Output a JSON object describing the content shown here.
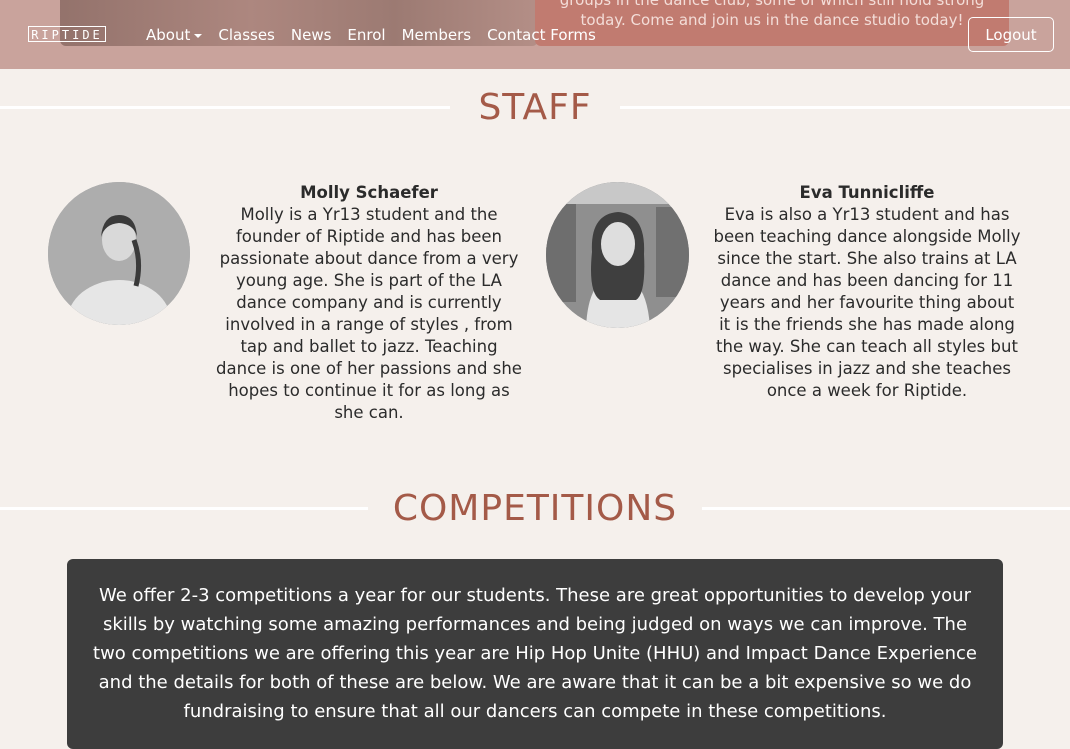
{
  "navbar": {
    "brand": "RIPTIDE",
    "hero_caption": "groups in the dance club, some of which still hold strong today. Come and join us in the dance studio today!",
    "links": [
      {
        "label": "About",
        "dropdown": true
      },
      {
        "label": "Classes"
      },
      {
        "label": "News"
      },
      {
        "label": "Enrol"
      },
      {
        "label": "Members"
      },
      {
        "label": "Contact Forms"
      }
    ],
    "logout_label": "Logout"
  },
  "staff": {
    "heading": "STAFF",
    "members": [
      {
        "name": "Molly Schaefer",
        "bio": "Molly is a Yr13 student and the founder of Riptide and has been passionate about dance from a very young age. She is part of the LA dance company and is currently involved in a range of styles , from tap and ballet to jazz. Teaching dance is one of her passions and she hopes to continue it for as long as she can."
      },
      {
        "name": "Eva Tunnicliffe",
        "bio": "Eva is also a Yr13 student and has been teaching dance alongside Molly since the start. She also trains at LA dance and has been dancing for 11 years and her favourite thing about it is the friends she has made along the way. She can teach all styles but specialises in jazz and she teaches once a week for Riptide."
      }
    ]
  },
  "competitions": {
    "heading": "COMPETITIONS",
    "text": "We offer 2-3 competitions a year for our students. These are great opportunities to develop your skills by watching some amazing performances and being judged on ways we can improve. The two competitions we are offering this year are Hip Hop Unite (HHU) and Impact Dance Experience and the details for both of these are below. We are aware that it can be a bit expensive so we do fundraising to ensure that all our dancers can compete in these competitions."
  },
  "colors": {
    "background": "#f5f0ec",
    "navbar": "#c9a39c",
    "heading": "#a45a48",
    "competition_box": "#3d3d3d"
  }
}
